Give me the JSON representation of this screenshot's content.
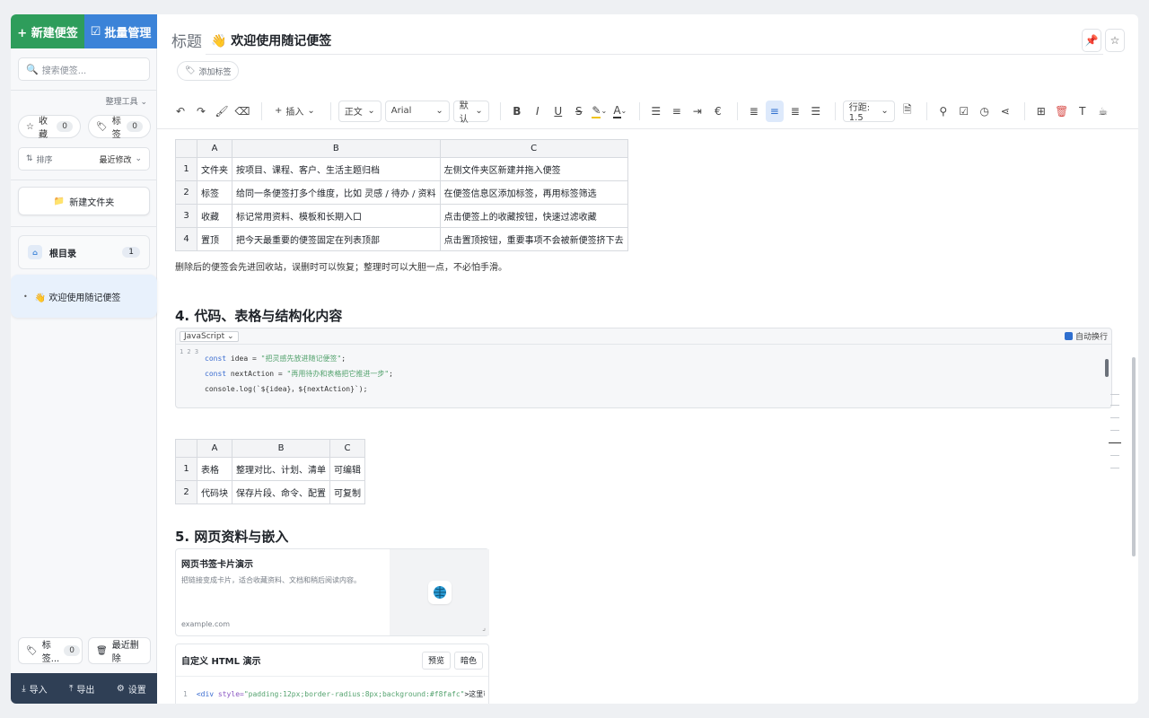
{
  "sidebar": {
    "new_note": "+ 新建便签",
    "batch_manage": "批量管理",
    "search_placeholder": "搜索便签...",
    "tools_label": "整理工具",
    "favorites": {
      "label": "收藏",
      "count": "0"
    },
    "tags": {
      "label": "标签",
      "count": "0"
    },
    "sort": {
      "label": "排序",
      "value": "最近修改"
    },
    "new_folder": "新建文件夹",
    "root": {
      "label": "根目录",
      "count": "1"
    },
    "note_item": "👋 欢迎使用随记便签",
    "tag_filter": {
      "label": "标签...",
      "count": "0"
    },
    "recent_deleted": "最近删除",
    "footer": {
      "import": "导入",
      "export": "导出",
      "settings": "设置"
    }
  },
  "editor": {
    "title_label": "标题",
    "title_text": "👋 欢迎使用随记便签",
    "add_tag": "添加标签",
    "toolbar": {
      "insert": "插入",
      "paragraph": "正文",
      "font": "Arial",
      "size": "默认",
      "line_height": "行距: 1.5"
    }
  },
  "content": {
    "table1": {
      "headers": [
        "A",
        "B",
        "C"
      ],
      "rows": [
        [
          "1",
          "文件夹",
          "按项目、课程、客户、生活主题归档",
          "左侧文件夹区新建并拖入便签"
        ],
        [
          "2",
          "标签",
          "给同一条便签打多个维度，比如 灵感 / 待办 / 资料",
          "在便签信息区添加标签，再用标签筛选"
        ],
        [
          "3",
          "收藏",
          "标记常用资料、模板和长期入口",
          "点击便签上的收藏按钮，快速过滤收藏"
        ],
        [
          "4",
          "置顶",
          "把今天最重要的便签固定在列表顶部",
          "点击置顶按钮，重要事项不会被新便签挤下去"
        ]
      ]
    },
    "paragraph": "删除后的便签会先进回收站，误删时可以恢复；整理时可以大胆一点，不必怕手滑。",
    "heading4": "4. 代码、表格与结构化内容",
    "code": {
      "language": "JavaScript",
      "wrap_label": "自动换行",
      "gutter": "1 2 3",
      "line1_kw": "const",
      "line1_var": " idea = ",
      "line1_str": "\"把灵感先放进随记便签\"",
      "line1_end": ";",
      "line2_kw": "const",
      "line2_var": " nextAction = ",
      "line2_str": "\"再用待办和表格把它推进一步\"",
      "line2_end": ";",
      "line3": "console.log(`${idea}，${nextAction}`);"
    },
    "table2": {
      "headers": [
        "A",
        "B",
        "C"
      ],
      "rows": [
        [
          "1",
          "表格",
          "整理对比、计划、清单",
          "可编辑"
        ],
        [
          "2",
          "代码块",
          "保存片段、命令、配置",
          "可复制"
        ]
      ]
    },
    "heading5": "5. 网页资料与嵌入",
    "bookmark": {
      "title": "网页书签卡片演示",
      "desc": "把链接变成卡片，适合收藏资料、文档和稍后阅读内容。",
      "domain": "example.com"
    },
    "html_embed": {
      "title": "自定义 HTML 演示",
      "preview": "预览",
      "dark": "暗色",
      "line_no": "1",
      "code_tag": "<div ",
      "code_attr": "style=",
      "code_val": "\"padding:12px;border-radius:8px;background:#f8fafc\"",
      "code_rest": ">这里可"
    }
  },
  "colors": {
    "new_note_bg": "#2e9d5b",
    "batch_bg": "#3b83d8",
    "footer_bg": "#2f3f55",
    "accent": "#2f6fcf"
  }
}
